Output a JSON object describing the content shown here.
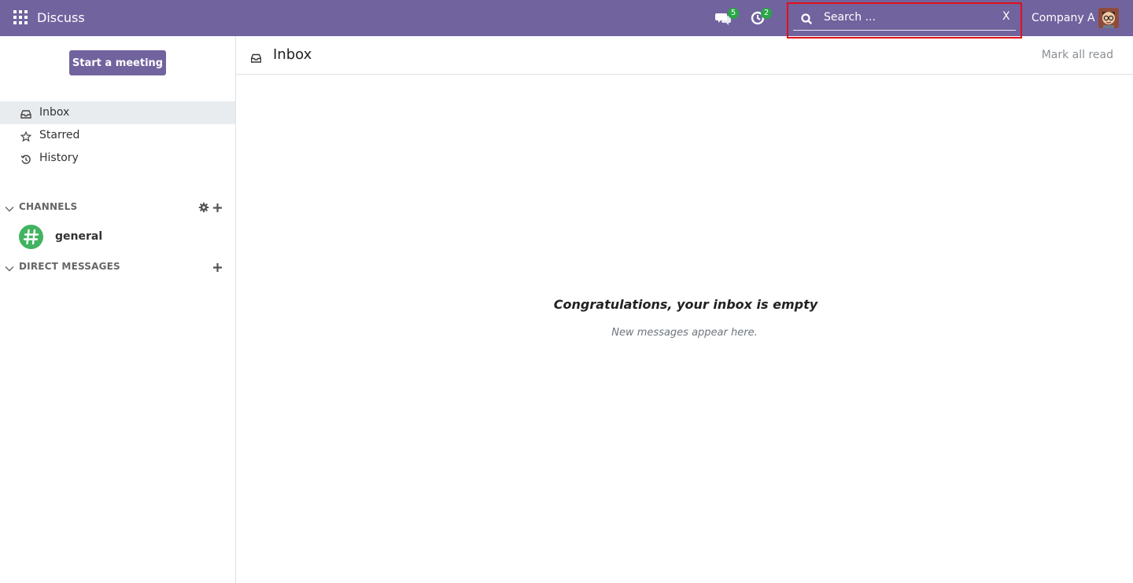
{
  "navbar": {
    "app_title": "Discuss",
    "messages_badge": "5",
    "activities_badge": "2",
    "search": {
      "placeholder": "Search ...",
      "value": "",
      "clear_label": "X"
    },
    "company": "Company A"
  },
  "sidebar": {
    "meeting_button": "Start a meeting",
    "mailboxes": [
      {
        "label": "Inbox",
        "icon": "inbox-icon",
        "active": true
      },
      {
        "label": "Starred",
        "icon": "star-icon",
        "active": false
      },
      {
        "label": "History",
        "icon": "history-icon",
        "active": false
      }
    ],
    "channels_header": "CHANNELS",
    "channels": [
      {
        "name": "general",
        "icon": "hashtag-icon"
      }
    ],
    "direct_messages_header": "DIRECT MESSAGES"
  },
  "main": {
    "title": "Inbox",
    "mark_all_read": "Mark all read",
    "empty_title": "Congratulations, your inbox is empty",
    "empty_subtitle": "New messages appear here."
  },
  "colors": {
    "brand": "#71639e",
    "badge": "#28a745",
    "channel_avatar": "#42b360",
    "highlight_border": "#e0101b"
  }
}
